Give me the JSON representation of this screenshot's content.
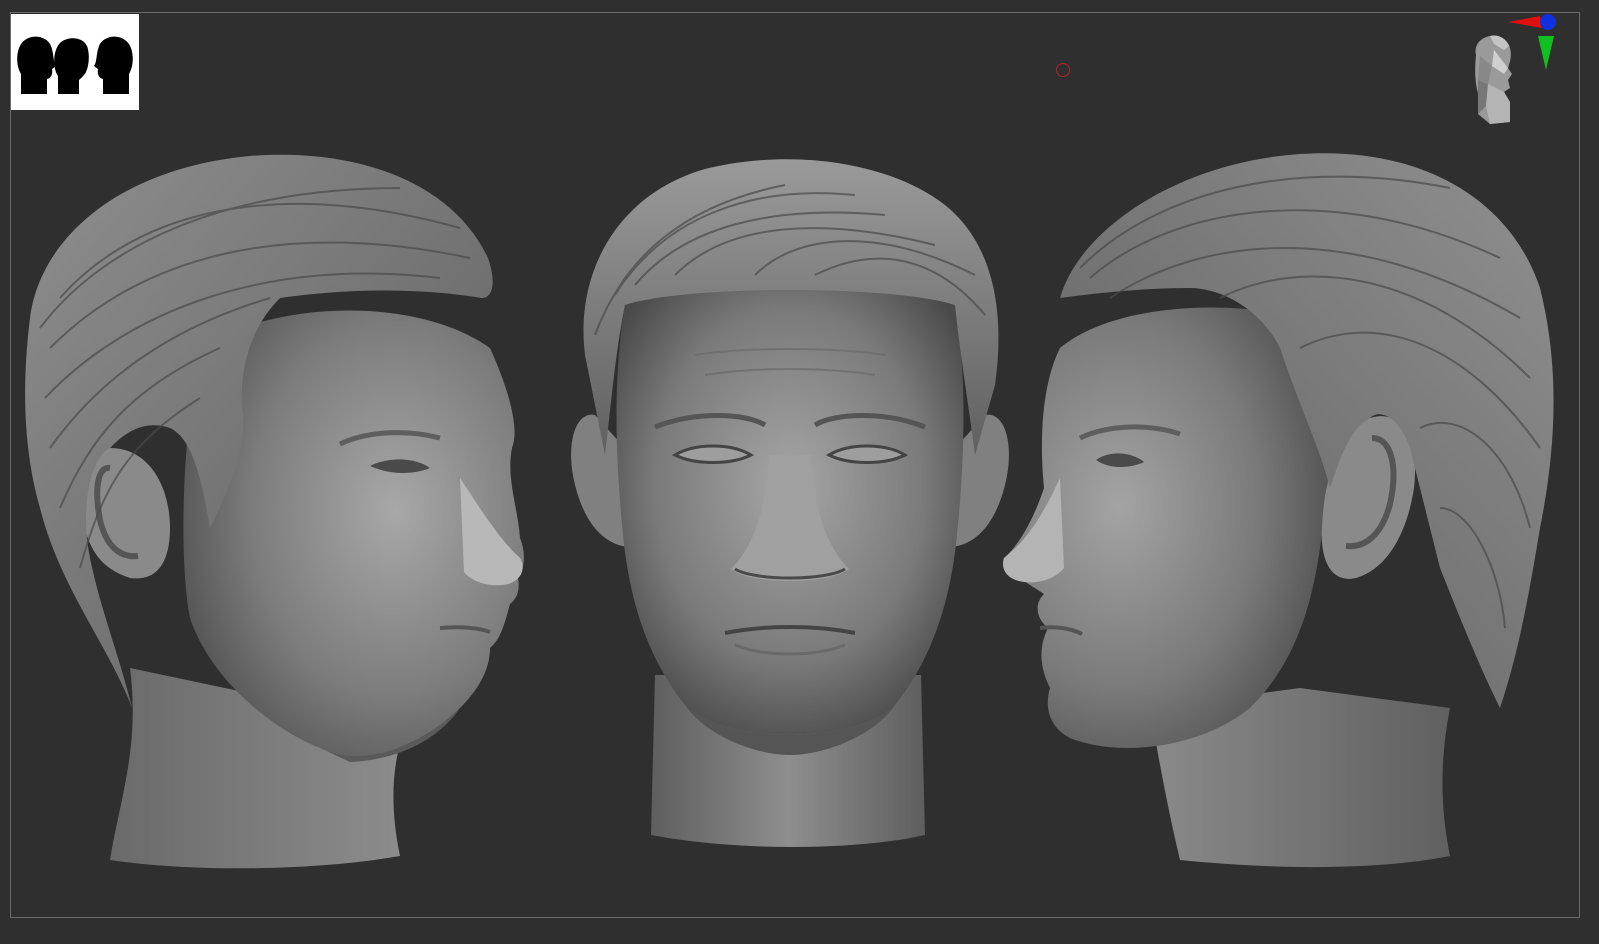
{
  "viewport": {
    "background_color": "#2f2f2f",
    "frame_color": "#6a6a6a",
    "sculpt_color": "#8a8a8a"
  },
  "thumbnail": {
    "icon": "head-silhouettes-icon",
    "background_color": "#ffffff"
  },
  "gizmo": {
    "icon": "navigation-head-icon",
    "axis_x_color": "#e01010",
    "axis_y_color": "#10c020",
    "axis_z_color": "#1030e0"
  },
  "cursor": {
    "icon": "brush-cursor-icon",
    "color": "#b02424"
  },
  "heads": [
    {
      "view": "three-quarter-left",
      "icon": "sculpted-head-left-icon"
    },
    {
      "view": "front",
      "icon": "sculpted-head-front-icon"
    },
    {
      "view": "profile-right",
      "icon": "sculpted-head-right-icon"
    }
  ]
}
